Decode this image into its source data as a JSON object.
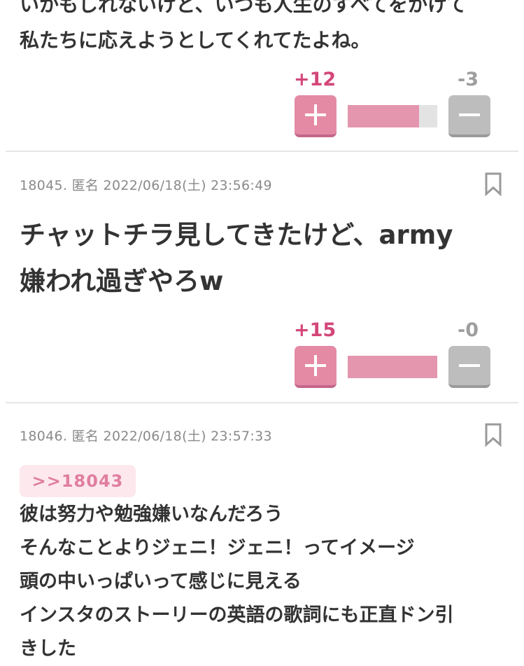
{
  "comments": [
    {
      "body_lines": [
        "いかもしれないけど、いつも人生のすべてをかけて",
        "私たちに応えようとしてくれてたよね。"
      ],
      "plus": "+12",
      "minus": "-3",
      "plus_ratio": 0.8
    },
    {
      "meta": "18045. 匿名 2022/06/18(土) 23:56:49",
      "body_lines": [
        "チャットチラ見してきたけど、army",
        "嫌われ過ぎやろw"
      ],
      "plus": "+15",
      "minus": "-0",
      "plus_ratio": 1.0
    },
    {
      "meta": "18046. 匿名 2022/06/18(土) 23:57:33",
      "anchor": ">>18043",
      "body_lines": [
        "彼は努力や勉強嫌いなんだろう",
        "そんなことよりジェニ！ジェニ！ってイメージ",
        "頭の中いっぱいって感じに見える",
        "インスタのストーリーの英語の歌詞にも正直ドン引",
        "きした"
      ]
    }
  ],
  "icons": {
    "bookmark": "bookmark-icon",
    "plus": "plus-icon",
    "minus": "minus-icon"
  },
  "colors": {
    "plus_accent": "#d4467a",
    "plus_button": "#e48aa5",
    "minus_button": "#bdbdbd",
    "bar_fill": "#e396ae",
    "bar_track": "#e3e3e3",
    "anchor_bg": "#fde8ee",
    "anchor_text": "#e07ea0"
  }
}
